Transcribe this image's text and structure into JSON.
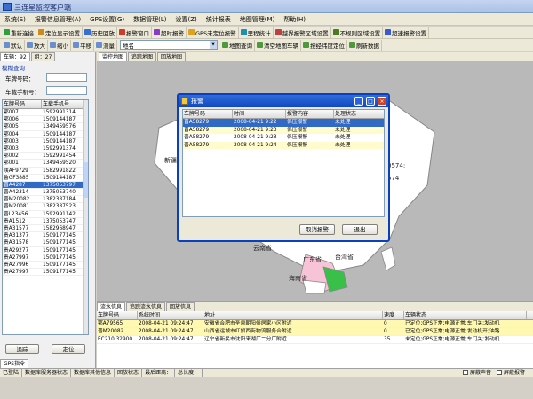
{
  "window": {
    "title": "三连星监控客户端"
  },
  "menu": [
    "系统(S)",
    "报警信息管理(A)",
    "GPS设置(G)",
    "数据管理(L)",
    "设置(Z)",
    "统计报表",
    "地图管理(M)",
    "帮助(H)"
  ],
  "toolbar1": [
    "重新连接",
    "定位显示设置",
    "历史回放",
    "报警窗口",
    "超时报警",
    "GPS未定位报警",
    "里程统计",
    "越界报警区域设置",
    "不规则区域设置",
    "超速报警设置"
  ],
  "toolbar2": {
    "buttons": [
      "默认",
      "放大",
      "缩小",
      "平移",
      "测量"
    ],
    "combo_value": "地名",
    "buttons2": [
      "地图查询",
      "清空地图车辆",
      "按经纬度定位",
      "刷新数据"
    ]
  },
  "left": {
    "tab_vehicles": "车辆：92",
    "tab_groups": "组：27",
    "fuzzy_title": "模糊查询",
    "plate_label": "车牌号码：",
    "phone_label": "车载手机号：",
    "columns": [
      "车牌号码",
      "车载手机号"
    ],
    "rows": [
      [
        "鄂007",
        "1592991314"
      ],
      [
        "鄂006",
        "1509144187"
      ],
      [
        "鄂005",
        "1349459576"
      ],
      [
        "鄂004",
        "1509144187"
      ],
      [
        "鄂003",
        "1509144187"
      ],
      [
        "鄂003",
        "1592991374"
      ],
      [
        "鄂002",
        "1592991454"
      ],
      [
        "鄂001",
        "1349459520"
      ],
      [
        "陕AF9729",
        "1582991822"
      ],
      [
        "鲁GF3885",
        "1509144187"
      ],
      [
        "晋A4287",
        "1375053797"
      ],
      [
        "晋A42314",
        "1375053740"
      ],
      [
        "晋M20082",
        "1382387184"
      ],
      [
        "晋M20081",
        "1382387523"
      ],
      [
        "晋L23456",
        "1592991142"
      ],
      [
        "贵A1512",
        "1375053747"
      ],
      [
        "贵A31577",
        "1582968947"
      ],
      [
        "贵A31377",
        "1509177145"
      ],
      [
        "贵A31578",
        "1509177145"
      ],
      [
        "贵A29277",
        "1509177145"
      ],
      [
        "贵A27997",
        "1509177145"
      ],
      [
        "贵A27996",
        "1509177145"
      ],
      [
        "贵A27997",
        "1509177145"
      ]
    ],
    "selected_row": 10,
    "btn_track": "追踪",
    "btn_locate": "定位",
    "gps_tab": "GPS指令"
  },
  "map": {
    "tabs": [
      "监控地图",
      "追踪地图",
      "回放地图"
    ],
    "labels": {
      "xinjiang": "新疆",
      "num": "0574;",
      "num2": "574",
      "yunnan": "云南省",
      "guangdong": "广东省",
      "taiwan": "台湾省",
      "hainan": "海南省"
    }
  },
  "dialog": {
    "title": "报警",
    "columns": [
      "车牌号码",
      "时间",
      "报警内容",
      "处理状态"
    ],
    "rows": [
      [
        "晋A58279",
        "2008-04-21 9:22",
        "係压报警",
        "未处理"
      ],
      [
        "晋A58279",
        "2008-04-21 9:23",
        "係压报警",
        "未处理"
      ],
      [
        "晋A58279",
        "2008-04-21 9:23",
        "係压报警",
        "未处理"
      ],
      [
        "晋A58279",
        "2008-04-21 9:24",
        "係压报警",
        "未处理"
      ]
    ],
    "btn_cancel": "取消报警",
    "btn_exit": "退出"
  },
  "bottom": {
    "tabs": [
      "流水信息",
      "追踪流水信息",
      "回放信息"
    ],
    "columns": [
      "车牌号码",
      "系统时间",
      "地址",
      "速度",
      "车辆状态"
    ],
    "rows": [
      [
        "鄂A79565",
        "2008-04-21 09:24:47",
        "安徽省合肥市圣泉朝阳侨居家小区附近",
        "0",
        "已定位;GPS正常;电源正常;车门关;发动机"
      ],
      [
        "晋M20082",
        "2008-04-21 09:24:47",
        "山西省运城市红旗西街物流服务合附近",
        "0",
        "已定位;GPS正常;电源正常;发动机开;油路"
      ],
      [
        "EC210  32900",
        "2008-04-21 09:24:47",
        "辽宁省新民市沈阳来湖厂二分厂附近",
        "35",
        "未定位;GPS正常;电源正常;车门关;发动机"
      ]
    ]
  },
  "status": {
    "items": [
      "已登陆",
      "数据库服务器状态",
      "数据库其他信息",
      "回放状态",
      "最后距离：",
      "总长度："
    ],
    "chk1": "屏蔽声音",
    "chk2": "屏蔽报警"
  }
}
